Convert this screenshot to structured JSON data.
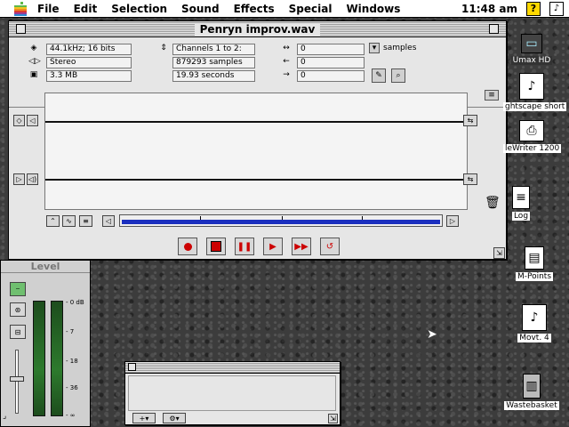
{
  "menubar": {
    "menus": [
      "File",
      "Edit",
      "Selection",
      "Sound",
      "Effects",
      "Special",
      "Windows"
    ],
    "clock": "11:48 am",
    "help_icon": "help-icon",
    "app_icon": "sound-app-icon"
  },
  "main_window": {
    "title": "Penryn improv.wav",
    "format": "44.1kHz; 16 bits",
    "channels_mode": "Stereo",
    "size": "3.3 MB",
    "channels": "Channels 1 to 2:",
    "sample_count": "879293 samples",
    "duration": "19.93 seconds",
    "range_start": "0",
    "range_mid": "0",
    "range_end": "0",
    "units": "samples"
  },
  "level_window": {
    "title": "Level",
    "scale": [
      "- 0 dB",
      "- 7",
      "- 18",
      "- 36",
      "- ∞"
    ]
  },
  "desktop_icons": [
    {
      "label": "Umax HD",
      "icon": "hard-disk-icon"
    },
    {
      "label": "ghtscape short",
      "icon": "music-document-icon"
    },
    {
      "label": "leWriter 1200",
      "icon": "printer-icon"
    },
    {
      "label": "Log",
      "icon": "text-document-icon"
    },
    {
      "label": "M-Points",
      "icon": "document-icon"
    },
    {
      "label": "Movt. 4",
      "icon": "music-document-icon"
    },
    {
      "label": "Wastebasket",
      "icon": "trash-icon"
    }
  ],
  "colors": {
    "accent": "#1b2fbf",
    "record": "#cc0000",
    "meter": "#2d7a2d"
  }
}
